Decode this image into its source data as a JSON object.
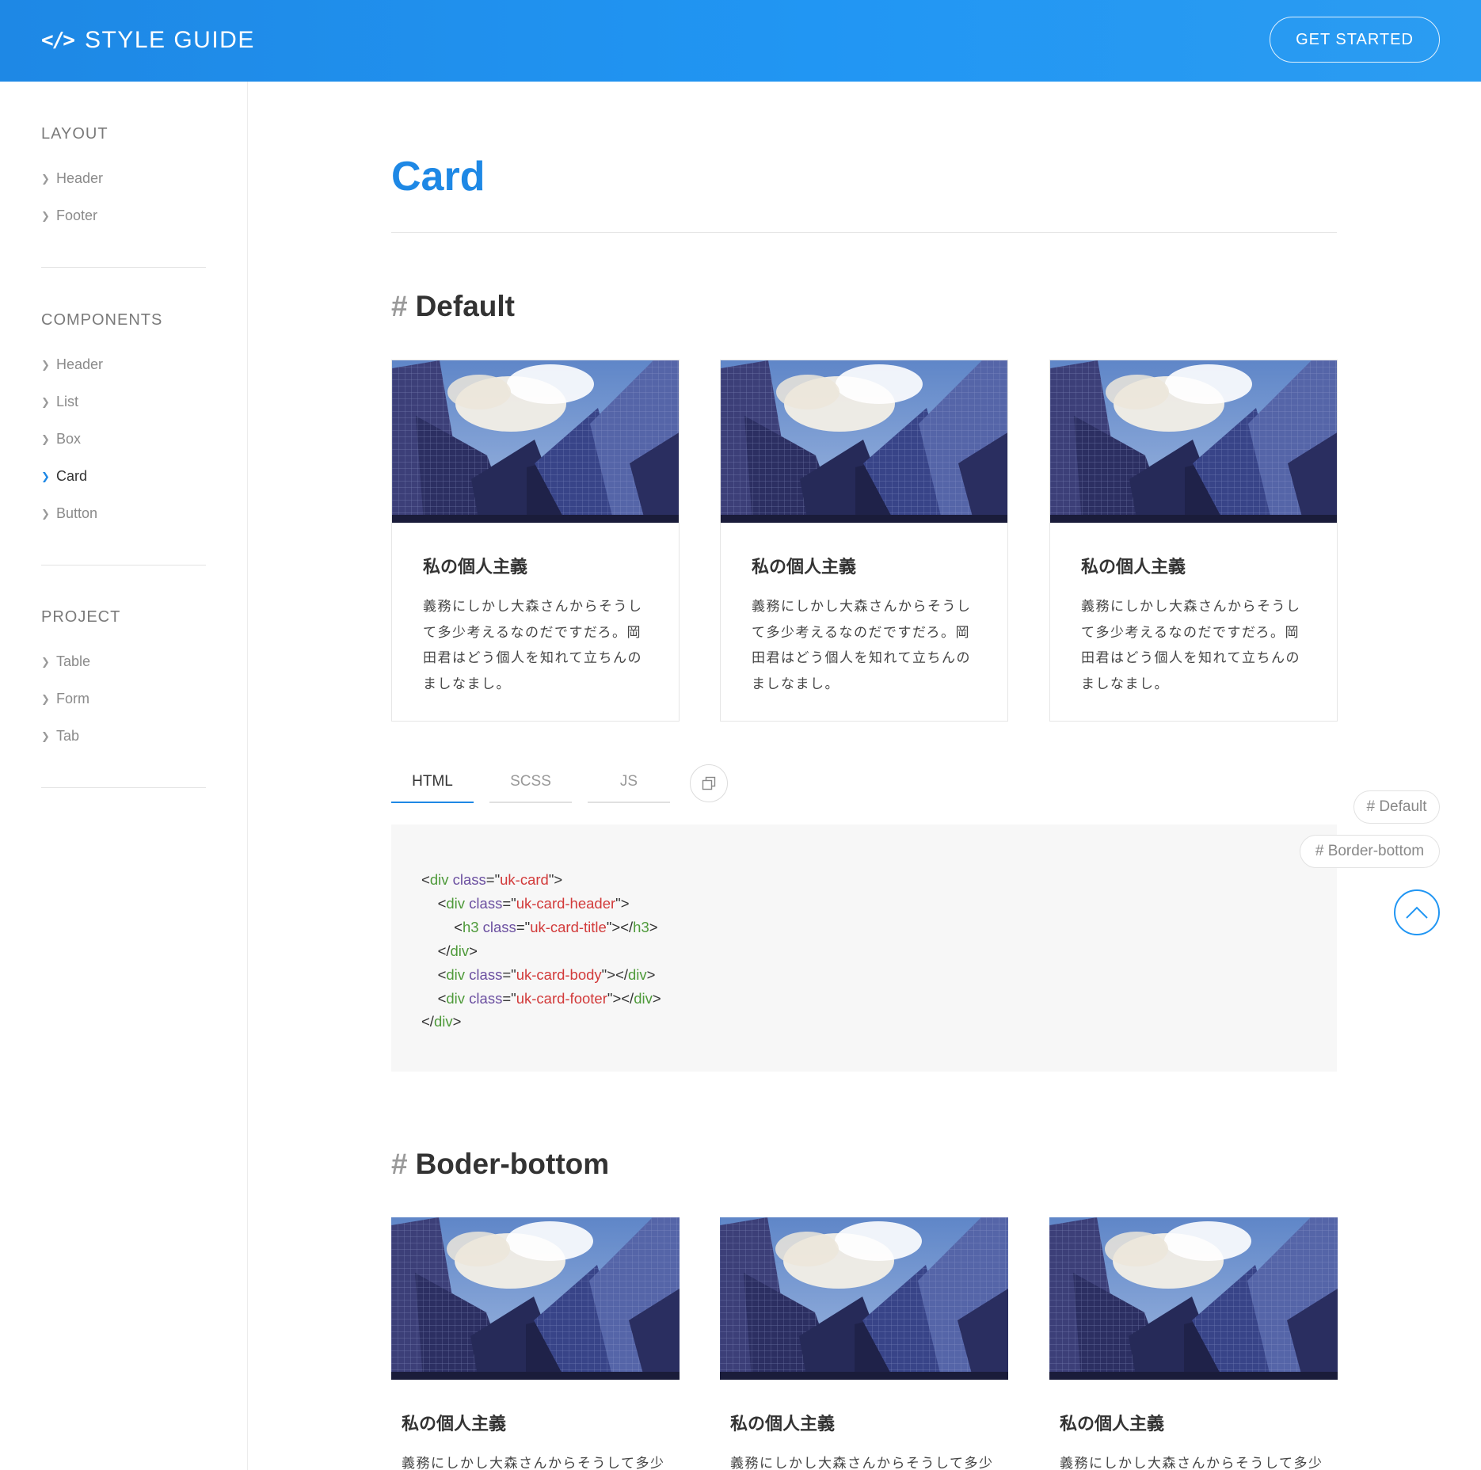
{
  "header": {
    "brand_icon": "</>",
    "brand_title": "STYLE GUIDE",
    "cta_label": "GET STARTED"
  },
  "sidebar": {
    "sections": [
      {
        "heading": "LAYOUT",
        "items": [
          "Header",
          "Footer"
        ]
      },
      {
        "heading": "COMPONENTS",
        "items": [
          "Header",
          "List",
          "Box",
          "Card",
          "Button"
        ]
      },
      {
        "heading": "PROJECT",
        "items": [
          "Table",
          "Form",
          "Tab"
        ]
      }
    ],
    "active_item": "Card"
  },
  "main": {
    "page_title": "Card",
    "sections": [
      {
        "hash": "#",
        "title": "Default"
      },
      {
        "hash": "#",
        "title": "Boder-bottom"
      }
    ],
    "card": {
      "title": "私の個人主義",
      "text_default": "義務にしかし大森さんからそうして多少考えるなのだですだろ。岡田君はどう個人を知れて立ちんのましなまし。",
      "text_default_lines": [
        "義務にしかし大森さんからそうし",
        "て多少考えるなのだですだろ。岡",
        "田君はどう個人を知れて立ちんの",
        "ましなまし。"
      ],
      "text_border_first_line": "義務にしかし大森さんからそうして多少"
    },
    "tabs": [
      "HTML",
      "SCSS",
      "JS"
    ],
    "active_tab": "HTML",
    "code_lines": [
      "<div class=\"uk-card\">",
      "    <div class=\"uk-card-header\">",
      "        <h3 class=\"uk-card-title\"></h3>",
      "    </div>",
      "    <div class=\"uk-card-body\"></div>",
      "    <div class=\"uk-card-footer\"></div>",
      "</div>"
    ]
  },
  "floating_nav": {
    "links": [
      "# Default",
      "# Border-bottom"
    ],
    "to_top_icon": "chevron-up-icon"
  },
  "colors": {
    "accent": "#1e88e5",
    "code_tag": "#4e9a3a",
    "code_attr": "#6b4fa0",
    "code_string": "#d23a3a"
  }
}
